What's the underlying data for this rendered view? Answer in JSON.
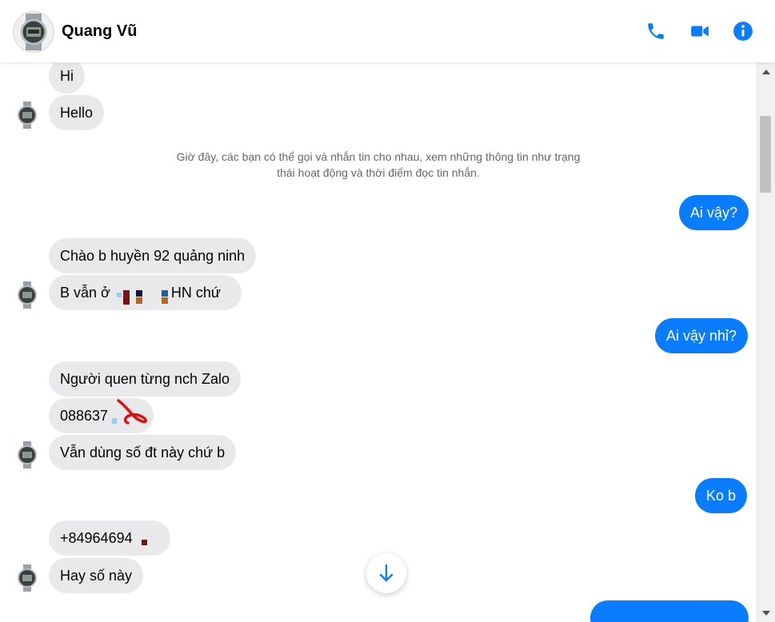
{
  "header": {
    "contact_name": "Quang Vũ",
    "icons": [
      "phone-icon",
      "video-call-icon",
      "info-icon"
    ]
  },
  "colors": {
    "accent": "#0a7cff",
    "incoming_bubble": "#e9e9eb",
    "notice_text": "#65676b"
  },
  "messages": {
    "m1": "Hi",
    "m2": "Hello",
    "notice_line1": "Giờ đây, các bạn có thể gọi và nhắn tin cho nhau, xem những thông tin như trạng",
    "notice_line2": "thái hoạt động và thời điểm đọc tin nhắn.",
    "m3": "Ai vậy?",
    "m4": "Chào b huyền 92 quảng ninh",
    "m5a": "B vẫn ở ",
    "m5b": "HN chứ",
    "m6": "Ai vậy nhỉ?",
    "m7": "Người quen từng nch Zalo",
    "m8": "088637",
    "m9": "Vẫn dùng số đt này chứ b",
    "m10": "Ko b",
    "m11": "+84964694",
    "m12": "Hay số này"
  }
}
